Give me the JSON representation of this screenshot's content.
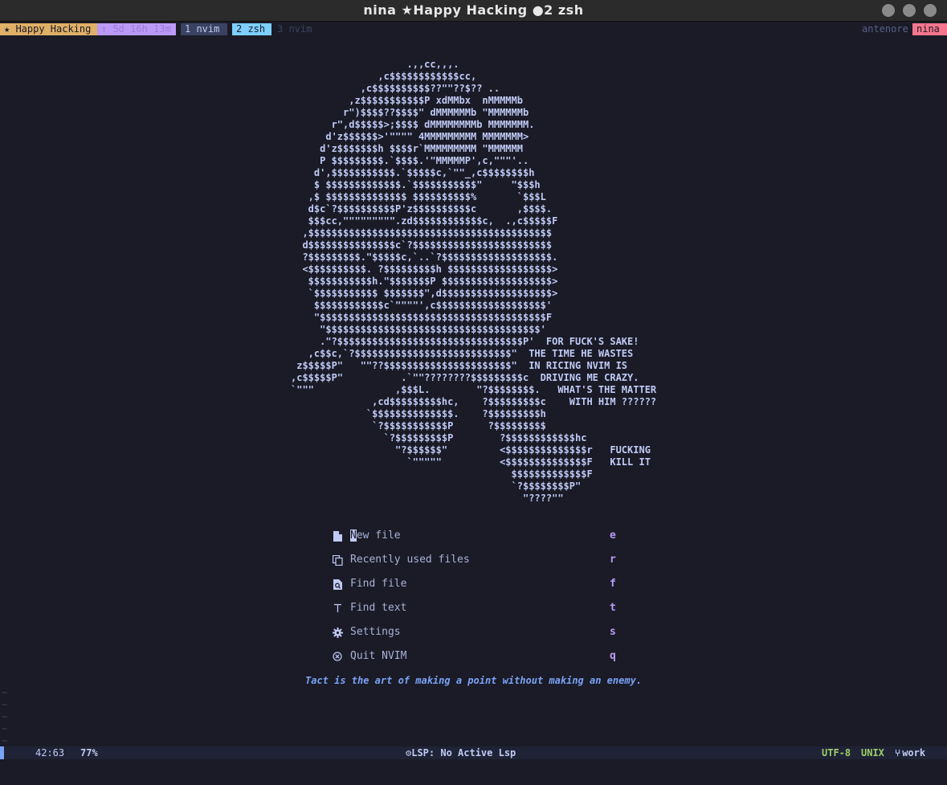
{
  "window": {
    "title": "nina ★Happy Hacking ●2 zsh"
  },
  "tmux": {
    "session": "★ Happy Hacking",
    "uptime": "↑ 5d 16h 13m",
    "windows": [
      {
        "label": "1 nvim",
        "active": false
      },
      {
        "label": "2 zsh",
        "active": true
      },
      {
        "label": "3 nvim",
        "active": false
      }
    ],
    "host": "antenore",
    "user": "nina"
  },
  "ascii_art": [
    "                    .,,cc,,,.",
    "               ,c$$$$$$$$$$$$cc,",
    "            ,c$$$$$$$$$$??\"\"??$?? ..",
    "          ,z$$$$$$$$$$$P xdMMbx  nMMMMMb",
    "         r\")$$$$??$$$$\" dMMMMMMb \"MMMMMMb",
    "       r\",d$$$$$>;$$$$ dMMMMMMMMb MMMMMMM.",
    "      d'z$$$$$$>'\"\"\"\" 4MMMMMMMMM MMMMMMM>",
    "     d'z$$$$$$$h $$$$r`MMMMMMMMM \"MMMMMM",
    "     P $$$$$$$$$.`$$$$.'\"MMMMMP',c,\"\"\"'..",
    "    d',$$$$$$$$$$$.`$$$$$c,`\"\"_,c$$$$$$$$h",
    "    $ $$$$$$$$$$$$$.`$$$$$$$$$$$\"     \"$$$h",
    "   ,$ $$$$$$$$$$$$$$ $$$$$$$$$$%       `$$$L",
    "   d$c`?$$$$$$$$$$P'z$$$$$$$$$$c       ,$$$$.",
    "   $$$cc,\"\"\"\"\"\"\"\"\".zd$$$$$$$$$$$$c,  .,c$$$$$F",
    "  ,$$$$$$$$$$$$$$$$$$$$$$$$$$$$$$$$$$$$$$$$$$",
    "  d$$$$$$$$$$$$$$$c`?$$$$$$$$$$$$$$$$$$$$$$$$",
    "  ?$$$$$$$$$.\"$$$$$c,`..`?$$$$$$$$$$$$$$$$$$$.",
    "  <$$$$$$$$$$. ?$$$$$$$$$h $$$$$$$$$$$$$$$$$$>",
    "   $$$$$$$$$$$h.\"$$$$$$$P $$$$$$$$$$$$$$$$$$$>",
    "   `$$$$$$$$$$$ $$$$$$$\",d$$$$$$$$$$$$$$$$$$$>",
    "    $$$$$$$$$$$$c`\"\"\"\"',c$$$$$$$$$$$$$$$$$$$'",
    "    \"$$$$$$$$$$$$$$$$$$$$$$$$$$$$$$$$$$$$$$$F",
    "     \"$$$$$$$$$$$$$$$$$$$$$$$$$$$$$$$$$$$$$'",
    "     .\"?$$$$$$$$$$$$$$$$$$$$$$$$$$$$$$$$P'  FOR FUCK'S SAKE!",
    "   ,c$$c,`?$$$$$$$$$$$$$$$$$$$$$$$$$$$\"  THE TIME HE WASTES",
    " z$$$$$P\"   \"\"??$$$$$$$$$$$$$$$$$$$$$$\"  IN RICING NVIM IS",
    ",c$$$$$P\"          .`\"\"????????$$$$$$$$$c  DRIVING ME CRAZY.",
    "`\"\"\"              ,$$$L.        \"?$$$$$$$$.   WHAT'S THE MATTER",
    "              ,cd$$$$$$$$$hc,    ?$$$$$$$$$c    WITH HIM ??????",
    "             `$$$$$$$$$$$$$$.    ?$$$$$$$$$h",
    "              `?$$$$$$$$$$$P      ?$$$$$$$$$",
    "                `?$$$$$$$$$P        ?$$$$$$$$$$$$hc",
    "                  \"?$$$$$$\"         <$$$$$$$$$$$$$$r   FUCKING",
    "                    `\"\"\"\"\"          <$$$$$$$$$$$$$$F   KILL IT",
    "                                      $$$$$$$$$$$$$F",
    "                                      `?$$$$$$$$P\"",
    "                                        \"????\"\""
  ],
  "dashboard": {
    "items": [
      {
        "icon": "new-file-icon",
        "label": "New file",
        "key": "e"
      },
      {
        "icon": "recent-files-icon",
        "label": "Recently used files",
        "key": "r"
      },
      {
        "icon": "find-file-icon",
        "label": "Find file",
        "key": "f"
      },
      {
        "icon": "find-text-icon",
        "label": "Find text",
        "key": "t"
      },
      {
        "icon": "settings-icon",
        "label": "Settings",
        "key": "s"
      },
      {
        "icon": "quit-icon",
        "label": "Quit NVIM",
        "key": "q"
      }
    ],
    "quote": "Tact is the art of making a point without making an enemy."
  },
  "tildes": [
    "~",
    "~",
    "~",
    "~",
    "~"
  ],
  "statusline": {
    "position": "42:63",
    "percent": "77%",
    "lsp": "LSP: No Active Lsp",
    "encoding": "UTF-8",
    "fileformat": "UNIX",
    "branch": "work"
  },
  "colors": {
    "background": "#1a1b26",
    "accent_blue": "#7aa2f7",
    "accent_purple": "#bb9af7",
    "accent_yellow": "#e0af68",
    "accent_cyan": "#7dcfff",
    "accent_red": "#f7768e",
    "accent_green": "#9ece6a"
  }
}
